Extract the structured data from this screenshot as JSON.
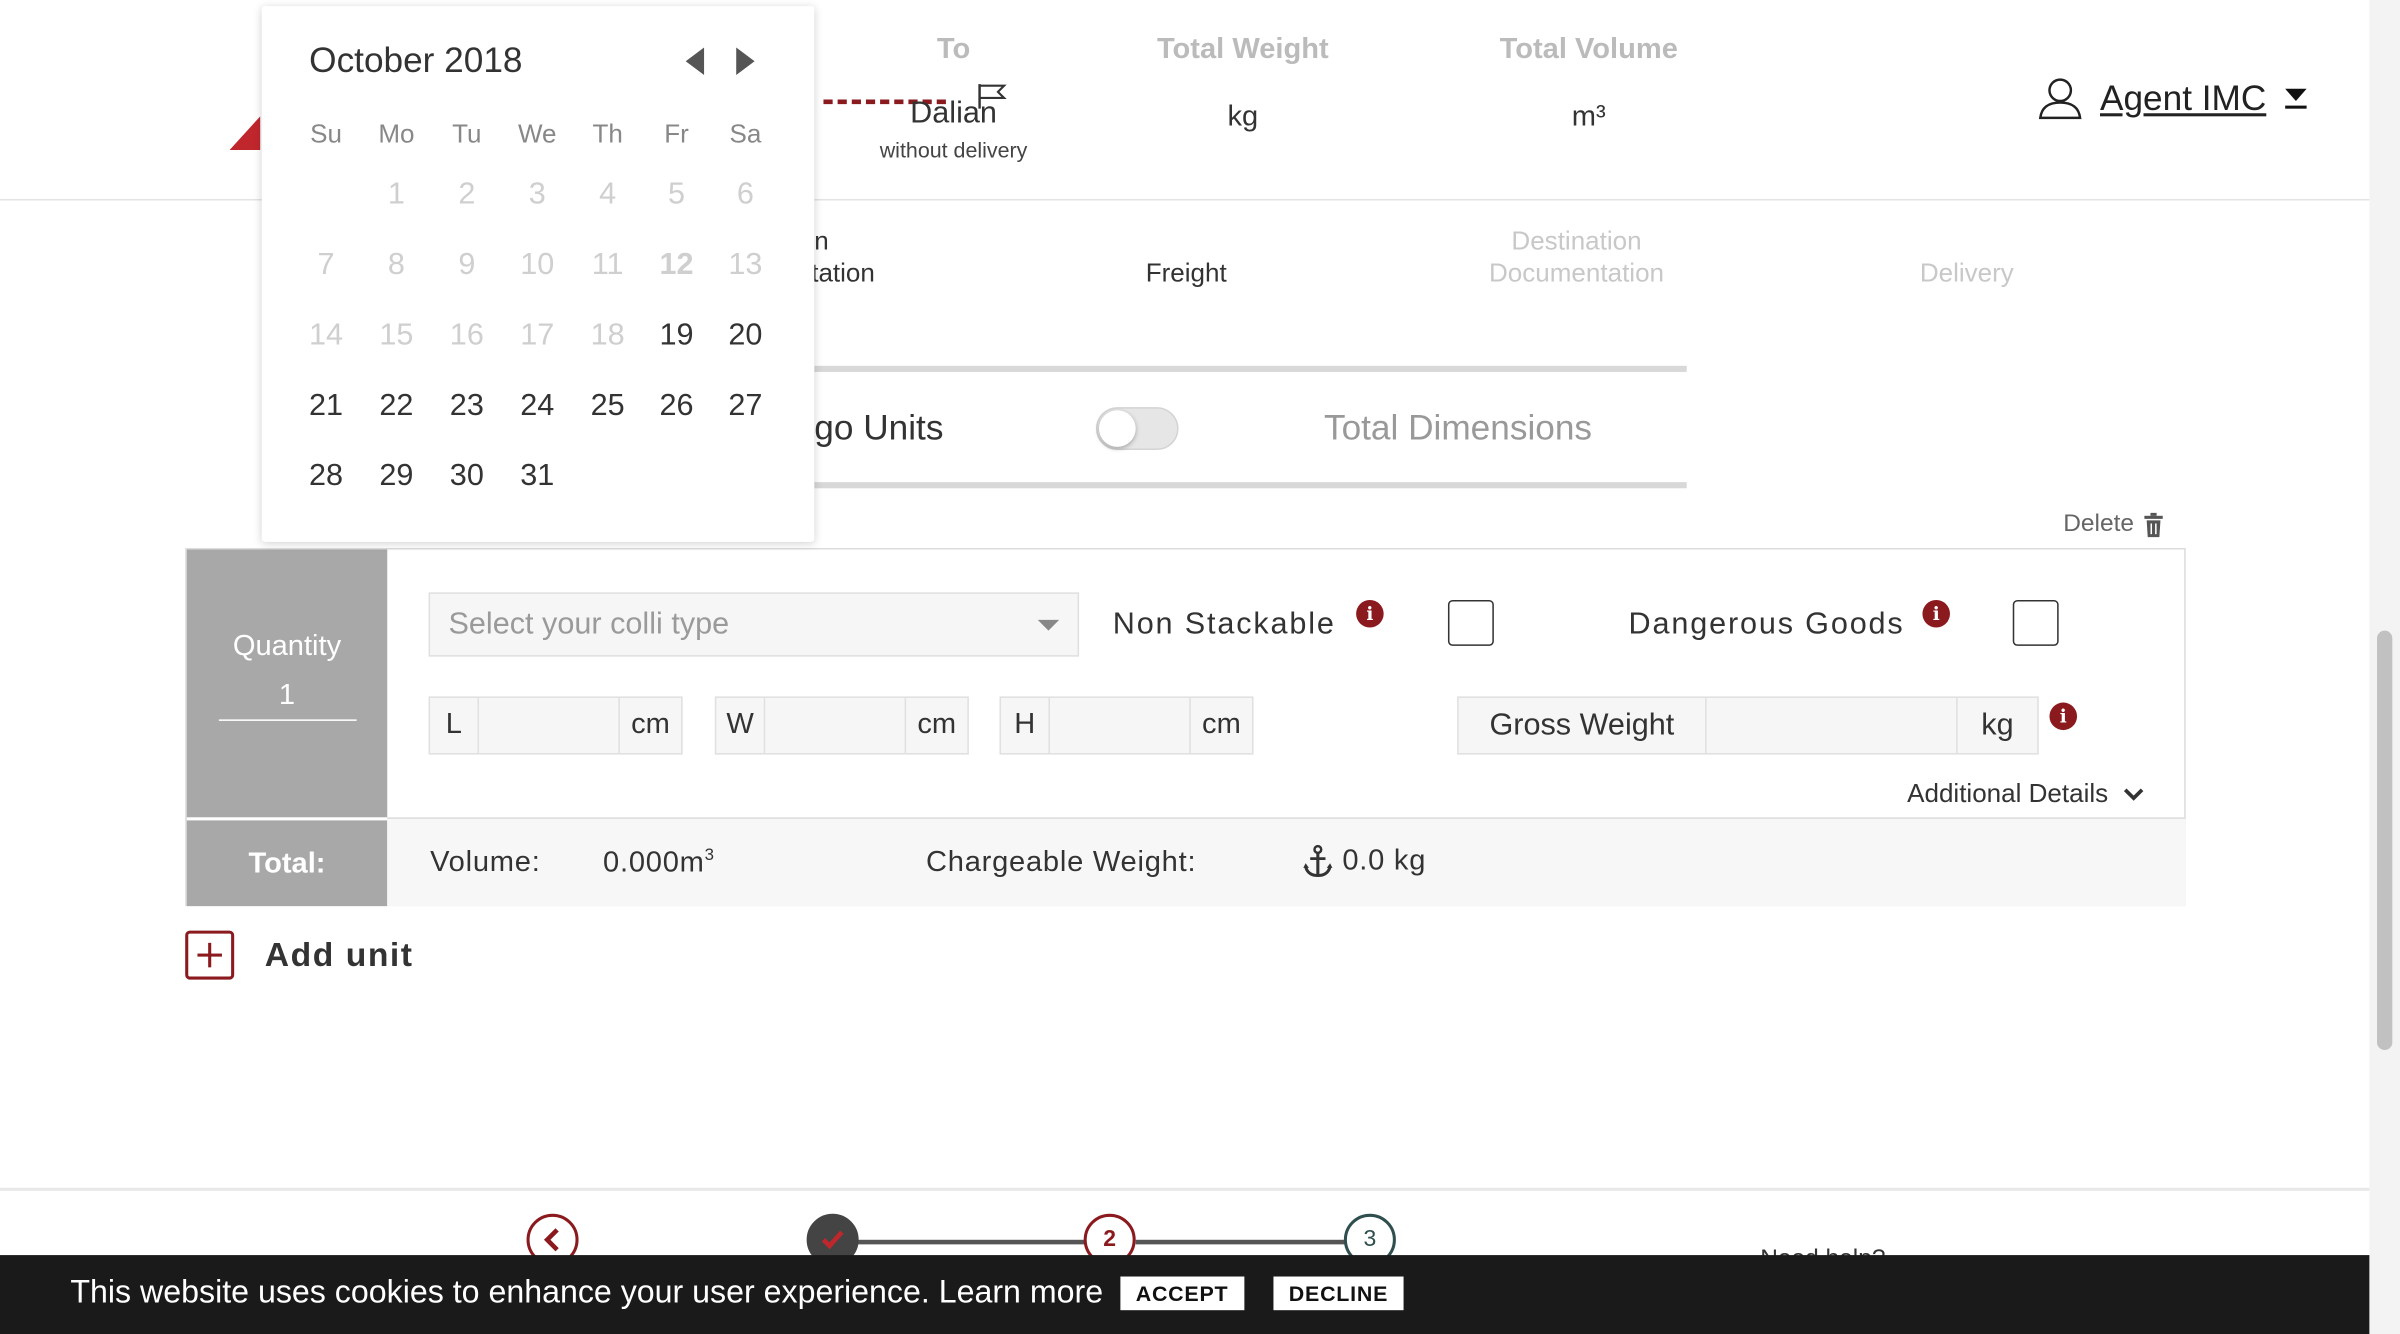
{
  "header": {
    "to_label": "To",
    "to_value": "Dalian",
    "to_sub": "without delivery",
    "total_weight_label": "Total Weight",
    "total_weight_unit": "kg",
    "total_volume_label": "Total Volume",
    "total_volume_unit": "m³",
    "user_name": "Agent IMC"
  },
  "steps": {
    "origin_line1": "n",
    "origin_line2": "tation",
    "freight": "Freight",
    "destination_line1": "Destination",
    "destination_line2": "Documentation",
    "delivery": "Delivery"
  },
  "mode": {
    "cargo_units": "go Units",
    "total_dimensions": "Total Dimensions"
  },
  "delete_label": "Delete",
  "unit": {
    "quantity_label": "Quantity",
    "quantity_value": "1",
    "colli_placeholder": "Select your colli type",
    "non_stackable": "Non Stackable",
    "dangerous_goods": "Dangerous Goods",
    "length_label": "L",
    "width_label": "W",
    "height_label": "H",
    "dim_unit": "cm",
    "gross_weight_label": "Gross Weight",
    "gross_weight_unit": "kg",
    "additional_details": "Additional Details",
    "total_label": "Total:",
    "volume_label": "Volume:",
    "volume_value": "0.000m",
    "volume_sup": "3",
    "chargeable_label": "Chargeable Weight:",
    "chargeable_value": "0.0 kg"
  },
  "add_unit": "Add unit",
  "footer": {
    "step2": "2",
    "step3": "3",
    "need_help": "Need help?"
  },
  "cookie": {
    "message": "This website uses cookies to enhance your user experience. Learn more",
    "accept": "ACCEPT",
    "decline": "DECLINE"
  },
  "calendar": {
    "title": "October 2018",
    "weekdays": [
      "Su",
      "Mo",
      "Tu",
      "We",
      "Th",
      "Fr",
      "Sa"
    ],
    "first_weekday_index": 1,
    "days_in_month": 31,
    "today": 12,
    "first_enabled": 19
  },
  "colors": {
    "accent": "#8b1a1f",
    "brand_red": "#c0272d",
    "qty_panel": "#a8a8a8",
    "cookie_bg": "#1a1a1a"
  }
}
